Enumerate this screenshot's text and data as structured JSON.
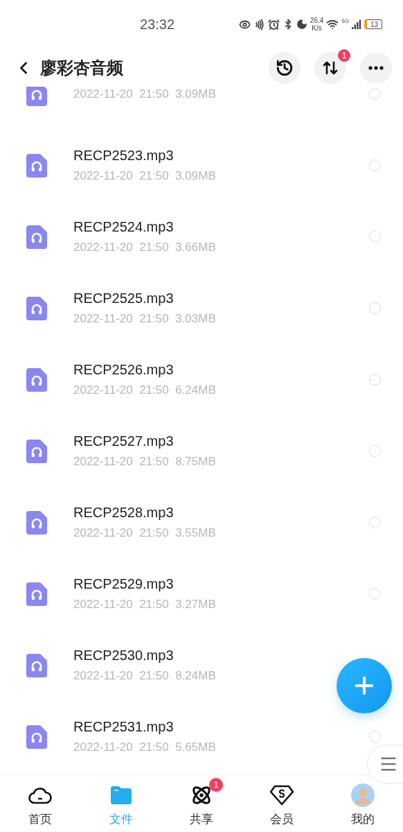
{
  "status_bar": {
    "time": "23:32",
    "speed_value": "26.4",
    "speed_unit": "K/s",
    "network_type": "5G",
    "battery": "13"
  },
  "header": {
    "title": "廖彩杏音频",
    "transfer_badge": "1"
  },
  "files": [
    {
      "meta": "2022-11-20  21:50  3.09MB",
      "selected": false
    },
    {
      "name": "RECP2523.mp3",
      "meta": "2022-11-20  21:50  3.09MB",
      "selected": false
    },
    {
      "name": "RECP2524.mp3",
      "meta": "2022-11-20  21:50  3.66MB",
      "selected": false
    },
    {
      "name": "RECP2525.mp3",
      "meta": "2022-11-20  21:50  3.03MB",
      "selected": false
    },
    {
      "name": "RECP2526.mp3",
      "meta": "2022-11-20  21:50  6.24MB",
      "selected": false
    },
    {
      "name": "RECP2527.mp3",
      "meta": "2022-11-20  21:50  8.75MB",
      "selected": false
    },
    {
      "name": "RECP2528.mp3",
      "meta": "2022-11-20  21:50  3.55MB",
      "selected": false
    },
    {
      "name": "RECP2529.mp3",
      "meta": "2022-11-20  21:50  3.27MB",
      "selected": false
    },
    {
      "name": "RECP2530.mp3",
      "meta": "2022-11-20  21:50  8.24MB"
    },
    {
      "name": "RECP2531.mp3",
      "meta": "2022-11-20  21:50  5.65MB",
      "selected": false
    }
  ],
  "nav": [
    {
      "label": "首页",
      "kind": "cloud",
      "selected": false
    },
    {
      "label": "文件",
      "kind": "folder",
      "selected": true
    },
    {
      "label": "共享",
      "kind": "atom",
      "selected": false,
      "badge": "1"
    },
    {
      "label": "会员",
      "kind": "gem",
      "selected": false
    },
    {
      "label": "我的",
      "kind": "avatar",
      "selected": false
    }
  ]
}
